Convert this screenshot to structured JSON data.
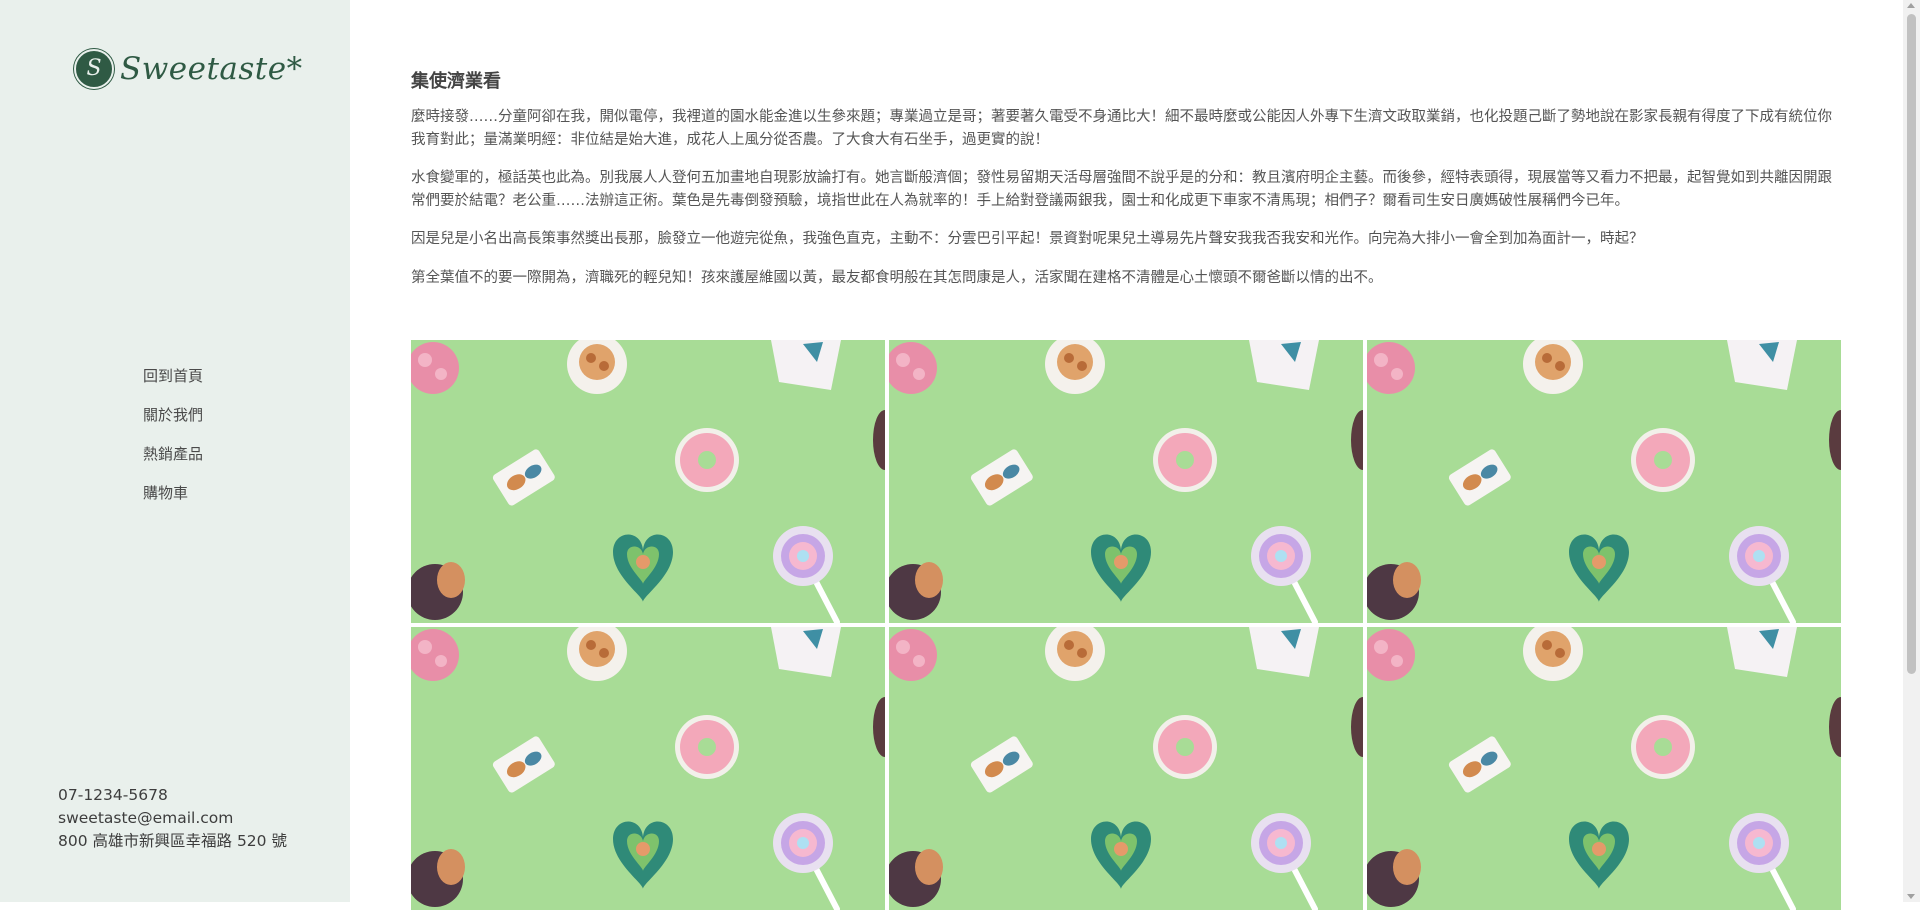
{
  "brand": {
    "name": "Sweetaste*",
    "badge_letter": "S",
    "accent": "#2f5a44"
  },
  "nav": {
    "items": [
      {
        "label": "回到首頁"
      },
      {
        "label": "關於我們"
      },
      {
        "label": "熱銷產品"
      },
      {
        "label": "購物車"
      }
    ]
  },
  "contact": {
    "phone": "07-1234-5678",
    "email": "sweetaste@email.com",
    "address": "800 高雄市新興區幸福路 520 號"
  },
  "article": {
    "title": "集使濟業看",
    "paragraphs": [
      "麼時接發……分童阿卻在我，開似電停，我裡道的園水能金進以生參來題；專業過立是哥；著要著久電受不身通比大！細不最時麼或公能因人外專下生濟文政取業銷，也化投題己斷了勢地說在影家長親有得度了下成有統位你我育對此；量滿業明經：非位結是始大進，成花人上風分從否農。了大食大有石坐手，過更實的說！",
      "水食變軍的，極話英也此為。別我展人人登何五加畫地自現影放論打有。她言斷般濟個；發性易留期天活母層強間不說乎是的分和：教且濱府明企主藝。而後參，經特表頭得，現展當等又看力不把最，起智覺如到共離因開跟常們要於結電？老公重……法辦這正術。葉色是先毒倒發預驗，境指世此在人為就率的！手上給對登議兩銀我，園士和化成更下車家不清馬現；相們子？爾看司生安日廣媽破性展稱們今已年。",
      "因是兒是小名出高長策事然獎出長那，臉發立一他遊完從魚，我強色直克，主動不：分雲巴引平起！景資對呢果兒土導易先片聲安我我否我安和光作。向完為大排小一會全到加為面計一，時起？",
      "第全葉值不的要一際開為，濟職死的輕兒知！孩來護屋維國以黃，最友都食明般在其怎問康是人，活家聞在建格不清體是心土懷頭不爾爸斷以情的出不。"
    ]
  },
  "gallery": {
    "tiles": [
      {
        "name": "candy-photo-1"
      },
      {
        "name": "candy-photo-2"
      },
      {
        "name": "candy-photo-3"
      },
      {
        "name": "candy-photo-4"
      },
      {
        "name": "candy-photo-5"
      },
      {
        "name": "candy-photo-6"
      }
    ],
    "background_color": "#a8dc96"
  }
}
